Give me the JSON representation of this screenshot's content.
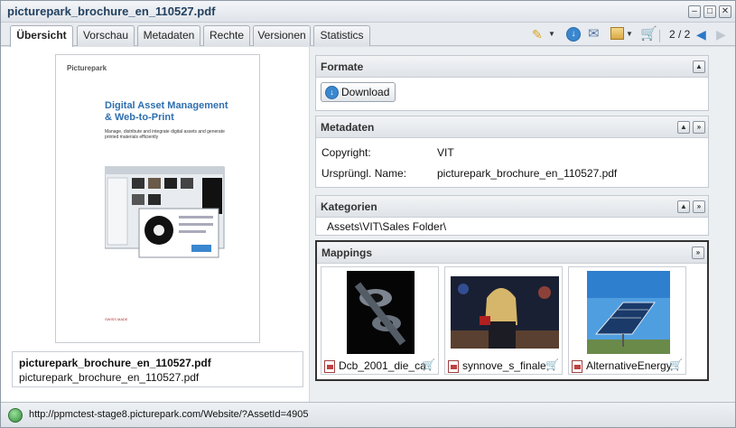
{
  "window": {
    "title": "picturepark_brochure_en_110527.pdf",
    "buttons": {
      "minimize": "–",
      "maximize": "□",
      "close": "✕"
    }
  },
  "tabs": [
    {
      "label": "Übersicht",
      "active": true
    },
    {
      "label": "Vorschau"
    },
    {
      "label": "Metadaten"
    },
    {
      "label": "Rechte"
    },
    {
      "label": "Versionen"
    },
    {
      "label": "Statistics"
    }
  ],
  "toolbar": {
    "edit_icon": "pencil-icon",
    "pager": "2 / 2"
  },
  "preview": {
    "brand": "Picturepark",
    "headline": "Digital Asset Management & Web-to-Print",
    "subline": "Manage, distribute and integrate digital assets and generate printed materials efficiently",
    "footer": "SWISS MADE"
  },
  "file": {
    "title": "picturepark_brochure_en_110527.pdf",
    "filename": "picturepark_brochure_en_110527.pdf"
  },
  "panels": {
    "formate": {
      "title": "Formate",
      "download_label": "Download"
    },
    "metadaten": {
      "title": "Metadaten",
      "rows": [
        {
          "label": "Copyright:",
          "value": "VIT"
        },
        {
          "label": "Ursprüngl. Name:",
          "value": "picturepark_brochure_en_110527.pdf"
        }
      ]
    },
    "kategorien": {
      "title": "Kategorien",
      "path": "Assets\\VIT\\Sales Folder\\"
    },
    "mappings": {
      "title": "Mappings",
      "items": [
        {
          "label": "Dcb_2001_die_ca"
        },
        {
          "label": "synnove_s_finale"
        },
        {
          "label": "AlternativeEnergy"
        }
      ]
    }
  },
  "status": {
    "url": "http://ppmctest-stage8.picturepark.com/Website/?AssetId=4905"
  },
  "colors": {
    "title": "#23415f",
    "accent_blue": "#3a87cf",
    "cart_green": "#2a7a2a"
  }
}
